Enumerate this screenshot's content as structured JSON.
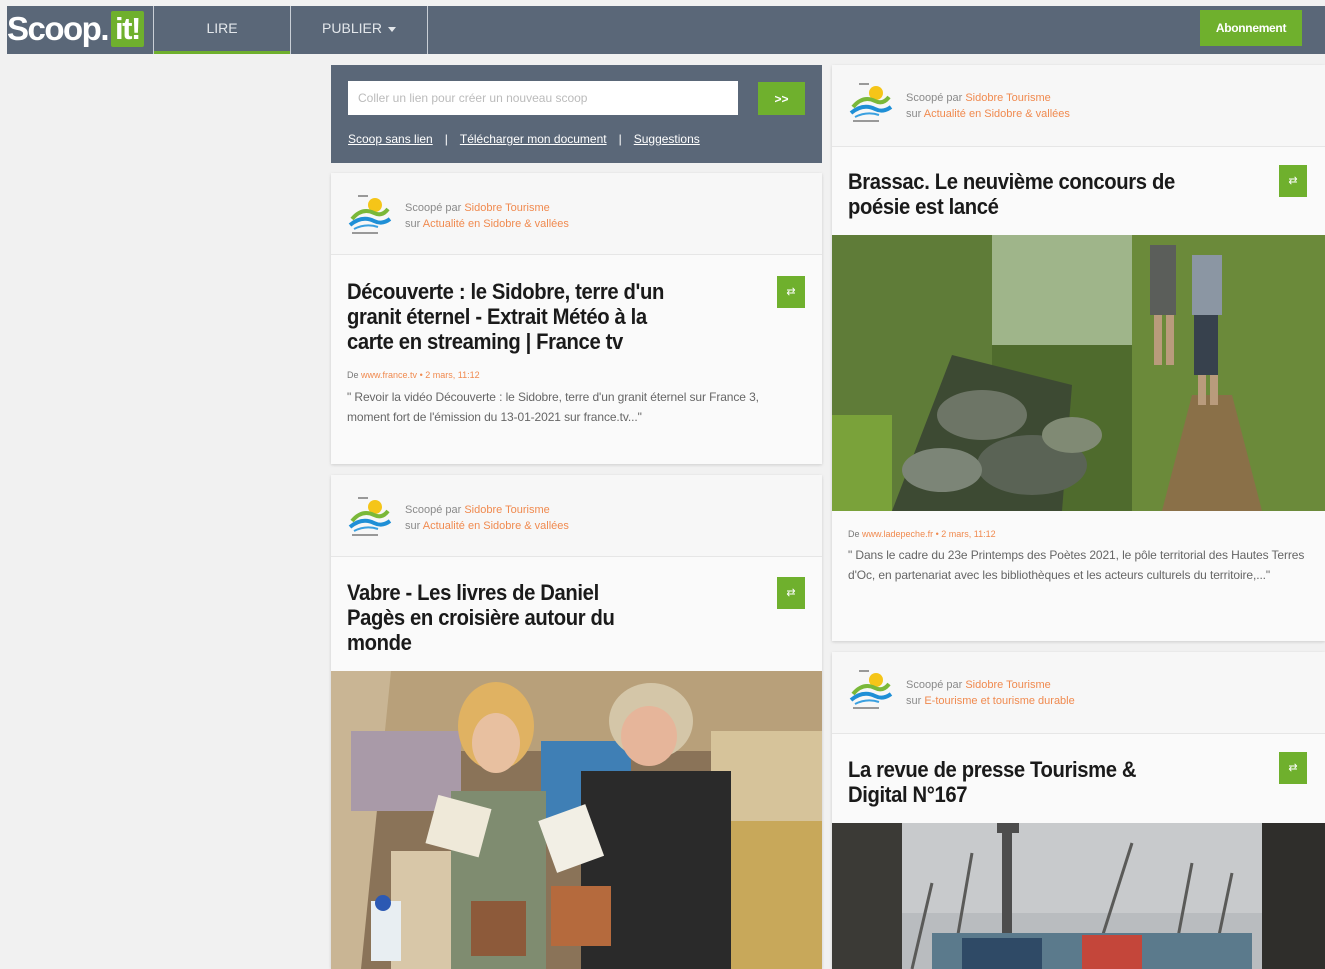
{
  "header": {
    "logo_main": "Scoop.",
    "logo_it": "it!",
    "nav": [
      {
        "label": "LIRE"
      },
      {
        "label": "PUBLIER"
      }
    ],
    "subscribe_label": "Abonnement"
  },
  "post_box": {
    "placeholder": "Coller un lien pour créer un nouveau scoop",
    "go_label": ">>",
    "links": [
      "Scoop sans lien",
      "Télécharger mon document",
      "Suggestions"
    ],
    "separator": "|"
  },
  "cards": [
    {
      "scooped_by_prefix": "Scoopé par",
      "curator": "Sidobre Tourisme",
      "on_prefix": "sur",
      "topic": "Actualité en Sidobre & vallées",
      "title": "Découverte : le Sidobre, terre d'un granit éternel - Extrait Météo à la carte en streaming | France tv",
      "source_prefix": "De",
      "source": "www.france.tv",
      "date": "2 mars, 11:12",
      "excerpt": "\" Revoir la vidéo Découverte : le Sidobre, terre d'un granit éternel sur France 3, moment fort de l'émission du 13-01-2021 sur france.tv...\""
    },
    {
      "scooped_by_prefix": "Scoopé par",
      "curator": "Sidobre Tourisme",
      "on_prefix": "sur",
      "topic": "Actualité en Sidobre & vallées",
      "title": "Vabre - Les livres de Daniel Pagès en croisière autour du monde"
    },
    {
      "scooped_by_prefix": "Scoopé par",
      "curator": "Sidobre Tourisme",
      "on_prefix": "sur",
      "topic": "Actualité en Sidobre & vallées",
      "title": "Brassac. Le neuvième concours de poésie est lancé",
      "source_prefix": "De",
      "source": "www.ladepeche.fr",
      "date": "2 mars, 11:12",
      "excerpt": "\" Dans le cadre du 23e Printemps des Poètes 2021, le pôle territorial des Hautes Terres d'Oc, en partenariat avec les bibliothèques et les acteurs culturels du territoire,...\""
    },
    {
      "scooped_by_prefix": "Scoopé par",
      "curator": "Sidobre Tourisme",
      "on_prefix": "sur",
      "topic": "E-tourisme et tourisme durable",
      "title": "La revue de presse Tourisme & Digital N°167"
    }
  ],
  "colors": {
    "header_bg": "#5a6778",
    "accent_green": "#6fb02d",
    "link_orange": "#f08a4f"
  }
}
